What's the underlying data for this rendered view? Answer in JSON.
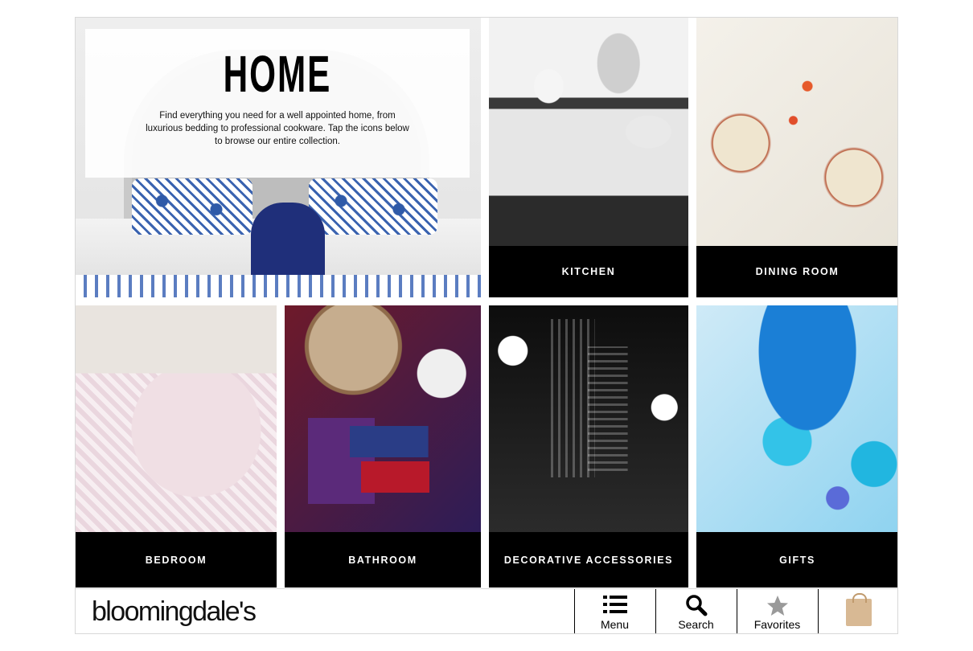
{
  "hero": {
    "title": "HOME",
    "description": "Find everything you need for a well appointed home, from luxurious bedding to professional cookware. Tap the icons below to browse our entire collection."
  },
  "categories": [
    {
      "label": "KITCHEN"
    },
    {
      "label": "DINING ROOM"
    },
    {
      "label": "BEDROOM"
    },
    {
      "label": "BATHROOM"
    },
    {
      "label": "DECORATIVE ACCESSORIES"
    },
    {
      "label": "GIFTS"
    }
  ],
  "footer": {
    "logo": "bloomingdale's",
    "nav": [
      {
        "label": "Menu",
        "icon": "list-icon"
      },
      {
        "label": "Search",
        "icon": "search-icon"
      },
      {
        "label": "Favorites",
        "icon": "star-icon"
      },
      {
        "label": "",
        "icon": "shopping-bag-icon"
      }
    ]
  }
}
